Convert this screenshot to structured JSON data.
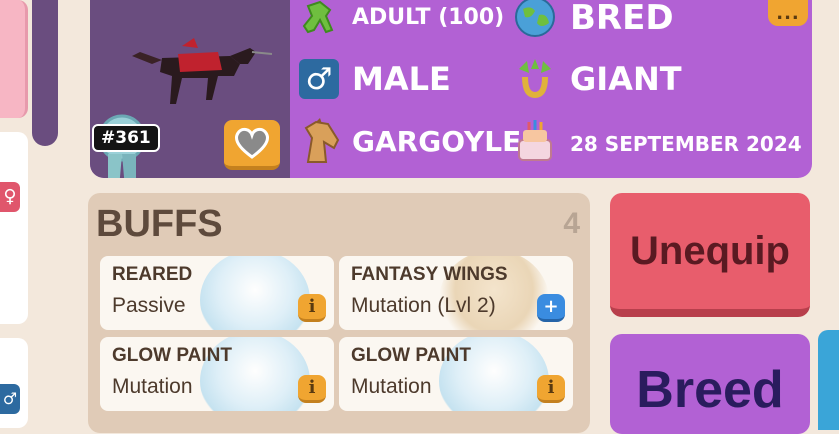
{
  "pet": {
    "id_badge": "#361",
    "age": "ADULT (100)",
    "gender": "MALE",
    "species": "GARGOYLE",
    "origin": "BRED",
    "size": "GIANT",
    "birthday": "28 SEPTEMBER 2024"
  },
  "buffs": {
    "title": "BUFFS",
    "count": "4",
    "items": [
      {
        "name": "REARED",
        "type": "Passive",
        "button": "info-icon"
      },
      {
        "name": "FANTASY WINGS",
        "type": "Mutation (Lvl 2)",
        "button": "plus-icon"
      },
      {
        "name": "GLOW PAINT",
        "type": "Mutation",
        "button": "info-icon"
      },
      {
        "name": "GLOW PAINT",
        "type": "Mutation",
        "button": "info-icon"
      }
    ]
  },
  "actions": {
    "unequip_label": "Unequip",
    "breed_label": "Breed"
  },
  "menu_label": "...",
  "colors": {
    "profile_bg": "#b261d4",
    "portrait_bg": "#6a4d7f",
    "unequip": "#e85d6c",
    "breed": "#b261d4",
    "buffs_panel": "#e0cbb7"
  }
}
